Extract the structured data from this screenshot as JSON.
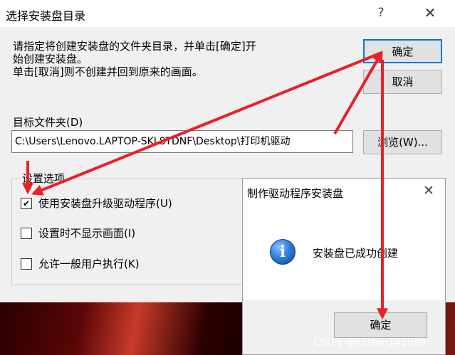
{
  "main_dialog": {
    "title": "选择安装盘目录",
    "help_glyph": "?",
    "close_glyph": "✕",
    "instruction": "请指定将创建安装盘的文件夹目录，并单击[确定]开\n始创建安装盘。\n单击[取消]则不创建并回到原来的画面。",
    "ok_label": "确定",
    "cancel_label": "取消",
    "folder_label": "目标文件夹(D)",
    "folder_value": "C:\\Users\\Lenovo.LAPTOP-SKL8TDNF\\Desktop\\打印机驱动",
    "browse_label": "浏览(W)...",
    "options_title": "设置选项",
    "options": [
      {
        "label": "使用安装盘升级驱动程序(U)",
        "checked": true
      },
      {
        "label": "设置时不显示画面(I)",
        "checked": false
      },
      {
        "label": "允许一般用户执行(K)",
        "checked": false
      }
    ]
  },
  "popup": {
    "title": "制作驱动程序安装盘",
    "close_glyph": "✕",
    "icon": "info-icon",
    "message": "安装盘已成功创建",
    "ok_label": "确定"
  },
  "watermark": "CSDN @Junson142099",
  "colors": {
    "annotation_arrow": "#e8202a",
    "focus_border": "#0078d7"
  }
}
